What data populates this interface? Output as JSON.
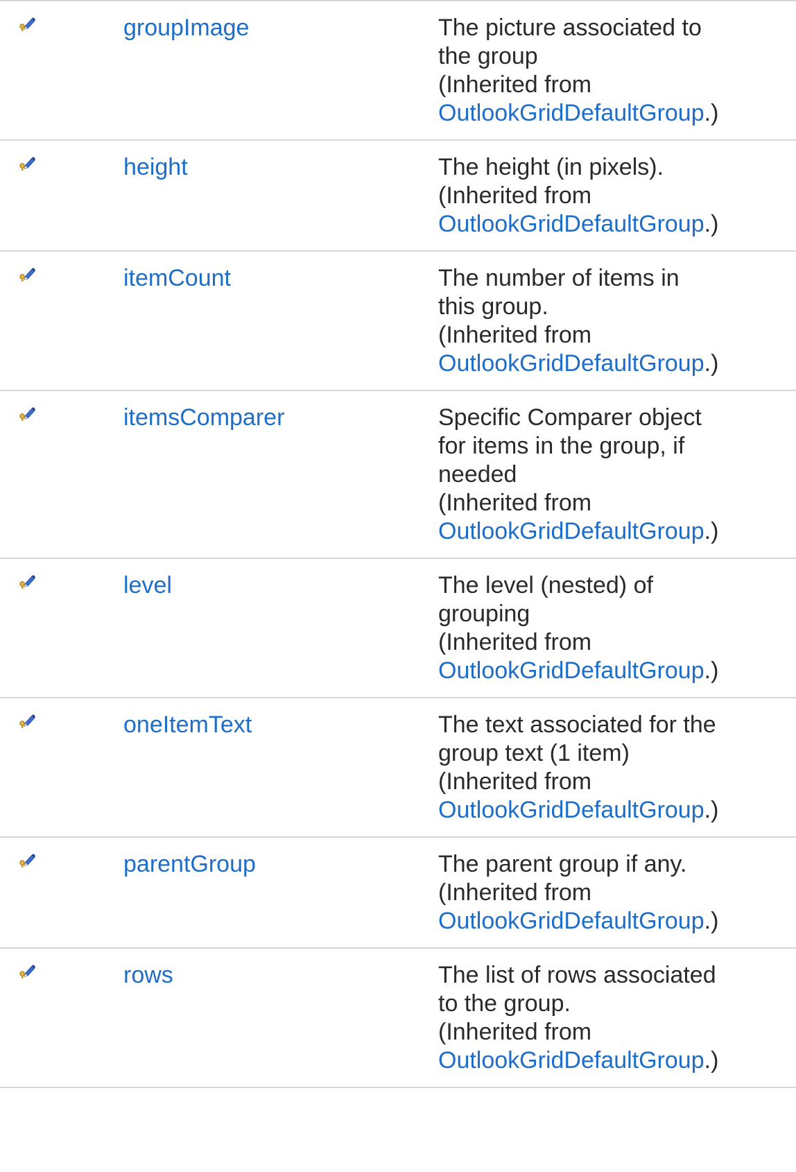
{
  "members": [
    {
      "name": "groupImage",
      "icon": "protected-property-icon",
      "desc_lines": [
        "The picture associated to",
        "the group"
      ],
      "inherited_prefix": "(Inherited from",
      "inherited_link": "OutlookGridDefaultGroup",
      "inherited_suffix": ".)"
    },
    {
      "name": "height",
      "icon": "protected-property-icon",
      "desc_lines": [
        "The height (in pixels)."
      ],
      "inherited_prefix": "(Inherited from",
      "inherited_link": "OutlookGridDefaultGroup",
      "inherited_suffix": ".)"
    },
    {
      "name": "itemCount",
      "icon": "protected-property-icon",
      "desc_lines": [
        "The number of items in",
        "this group."
      ],
      "inherited_prefix": "(Inherited from",
      "inherited_link": "OutlookGridDefaultGroup",
      "inherited_suffix": ".)"
    },
    {
      "name": "itemsComparer",
      "icon": "protected-property-icon",
      "desc_lines": [
        "Specific Comparer object",
        "for items in the group, if",
        "needed"
      ],
      "inherited_prefix": "(Inherited from",
      "inherited_link": "OutlookGridDefaultGroup",
      "inherited_suffix": ".)"
    },
    {
      "name": "level",
      "icon": "protected-property-icon",
      "desc_lines": [
        "The level (nested) of",
        "grouping"
      ],
      "inherited_prefix": "(Inherited from",
      "inherited_link": "OutlookGridDefaultGroup",
      "inherited_suffix": ".)"
    },
    {
      "name": "oneItemText",
      "icon": "protected-property-icon",
      "desc_lines": [
        "The text associated for the",
        "group text (1 item)"
      ],
      "inherited_prefix": "(Inherited from",
      "inherited_link": "OutlookGridDefaultGroup",
      "inherited_suffix": ".)"
    },
    {
      "name": "parentGroup",
      "icon": "protected-property-icon",
      "desc_lines": [
        "The parent group if any."
      ],
      "inherited_prefix": "(Inherited from",
      "inherited_link": "OutlookGridDefaultGroup",
      "inherited_suffix": ".)"
    },
    {
      "name": "rows",
      "icon": "protected-property-icon",
      "desc_lines": [
        "The list of rows associated",
        "to the group."
      ],
      "inherited_prefix": "(Inherited from",
      "inherited_link": "OutlookGridDefaultGroup",
      "inherited_suffix": ".)"
    }
  ],
  "colors": {
    "link": "#1e6ec9",
    "text": "#2a2a2a",
    "divider": "#d6d6d6"
  }
}
